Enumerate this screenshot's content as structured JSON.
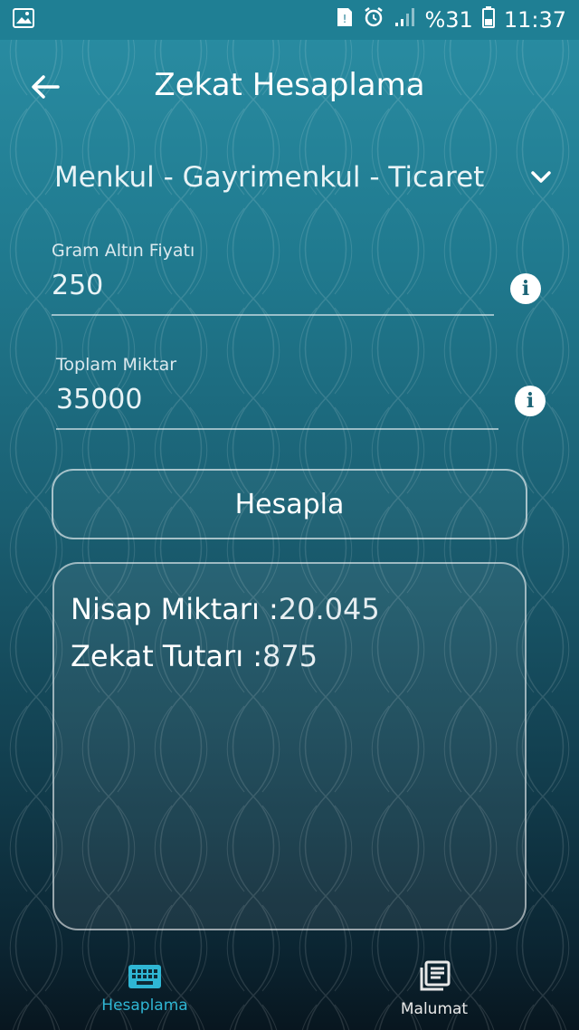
{
  "status_bar": {
    "battery_percent": "%31",
    "time": "11:37"
  },
  "header": {
    "title": "Zekat Hesaplama"
  },
  "category_dropdown": {
    "selected": "Menkul - Gayrimenkul - Ticaret"
  },
  "gold_price_field": {
    "label": "Gram Altın Fiyatı",
    "value": "250"
  },
  "total_amount_field": {
    "label": "Toplam Miktar",
    "value": "35000"
  },
  "calculate_button": {
    "label": "Hesapla"
  },
  "results": {
    "nisap_label": "Nisap Miktarı :",
    "nisap_value": "20.045",
    "zekat_label": "Zekat Tutarı :",
    "zekat_value": "875"
  },
  "bottom_nav": {
    "items": [
      {
        "label": "Hesaplama",
        "icon": "keyboard-icon",
        "active": true
      },
      {
        "label": "Malumat",
        "icon": "document-icon",
        "active": false
      }
    ]
  },
  "colors": {
    "accent": "#2fb6d4",
    "status_bar": "#1f7f94"
  }
}
